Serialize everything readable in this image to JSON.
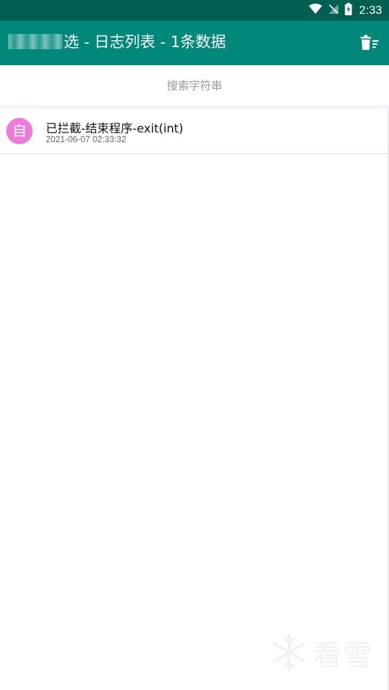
{
  "status_bar": {
    "time": "2:33",
    "icons": [
      "wifi-icon",
      "signal-icon",
      "battery-icon"
    ]
  },
  "app_bar": {
    "title": "选 - 日志列表 - 1条数据",
    "delete_icon": "trash-list-icon"
  },
  "search": {
    "placeholder": "搜索字符串",
    "value": ""
  },
  "logs": [
    {
      "avatar_char": "自",
      "title": "已拦截-结束程序-exit(int)",
      "time": "2021-06-07 02:33:32"
    }
  ],
  "watermark": {
    "text": "看雪",
    "icon": "snowflake-icon"
  },
  "colors": {
    "status_bar": "#005f50",
    "app_bar": "#00897b",
    "avatar": "#ee7ad9"
  }
}
